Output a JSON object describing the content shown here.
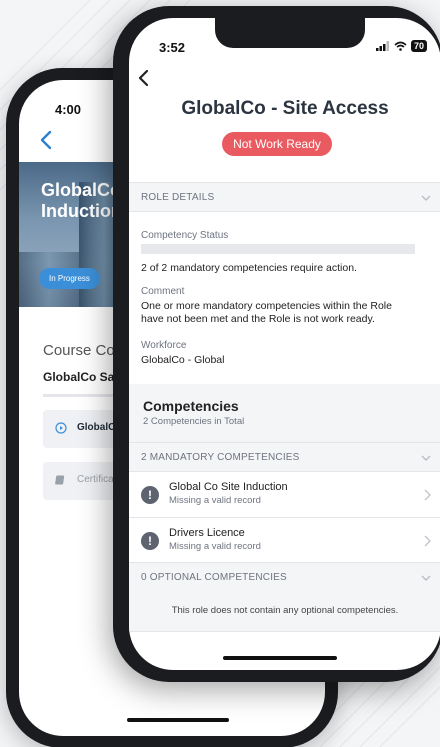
{
  "back_phone": {
    "time": "4:00",
    "hero_title": "GlobalCo Induction",
    "hero_badge": "In Progress",
    "course_heading": "Course Con",
    "course_subtitle": "GlobalCo Saf",
    "items": [
      {
        "label": "GlobalCo",
        "icon": "play-circle-icon"
      },
      {
        "label": "Certificat",
        "icon": "certificate-icon"
      }
    ]
  },
  "front_phone": {
    "time": "3:52",
    "battery": "70",
    "title": "GlobalCo - Site Access",
    "status": "Not Work Ready",
    "role_details_header": "ROLE DETAILS",
    "competency_status_label": "Competency Status",
    "competency_status_progress": 0,
    "competency_status_value": "2 of 2 mandatory competencies require action.",
    "comment_label": "Comment",
    "comment_value": "One or more mandatory competencies within the Role have not been met and the Role is not work ready.",
    "workforce_label": "Workforce",
    "workforce_value": "GlobalCo - Global",
    "competencies_title": "Competencies",
    "competencies_subtitle": "2 Competencies in Total",
    "mandatory_header": "2 MANDATORY COMPETENCIES",
    "mandatory": [
      {
        "name": "Global Co Site Induction",
        "status": "Missing a valid record"
      },
      {
        "name": "Drivers Licence",
        "status": "Missing a valid record"
      }
    ],
    "optional_header": "0 OPTIONAL COMPETENCIES",
    "optional_empty": "This role does not contain any optional competencies."
  },
  "colors": {
    "danger": "#e95b60",
    "accent": "#3b8fd8",
    "heading": "#2b3440"
  }
}
